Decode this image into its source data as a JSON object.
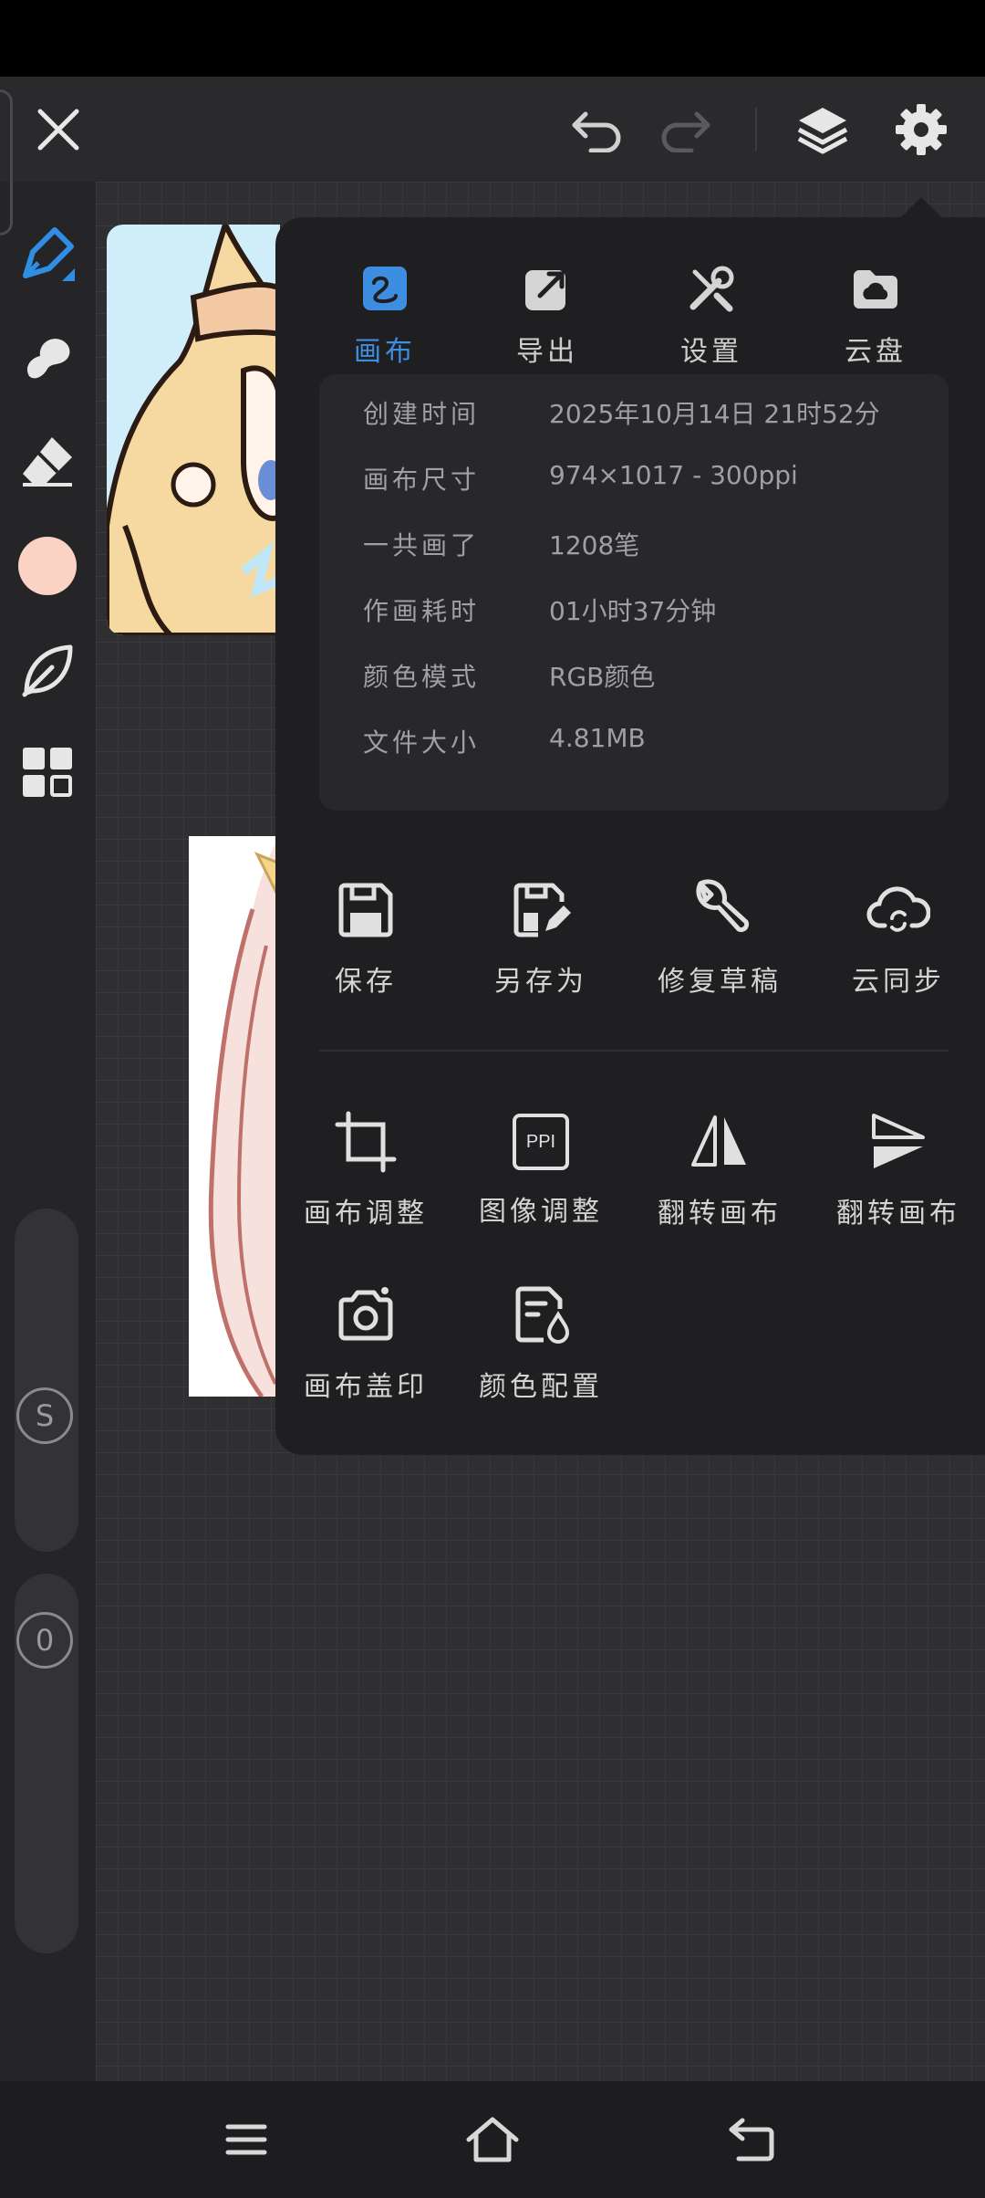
{
  "tabs": [
    {
      "label": "画布",
      "active": true
    },
    {
      "label": "导出",
      "active": false
    },
    {
      "label": "设置",
      "active": false
    },
    {
      "label": "云盘",
      "active": false
    }
  ],
  "info": {
    "created_label": "创建时间",
    "created_value": "2025年10月14日 21时52分",
    "size_label": "画布尺寸",
    "size_value": "974×1017 - 300ppi",
    "strokes_label": "一共画了",
    "strokes_value": "1208笔",
    "time_label": "作画耗时",
    "time_value": "01小时37分钟",
    "color_label": "颜色模式",
    "color_value": "RGB颜色",
    "file_label": "文件大小",
    "file_value": "4.81MB"
  },
  "actions": {
    "save": "保存",
    "save_as": "另存为",
    "repair": "修复草稿",
    "cloud_sync": "云同步",
    "canvas_adjust": "画布调整",
    "image_adjust": "图像调整",
    "flip_h": "翻转画布",
    "flip_v": "翻转画布",
    "stamp": "画布盖印",
    "color_config": "颜色配置"
  },
  "ppi_icon_text": "PPI",
  "sliders": {
    "size_letter": "S",
    "opacity_letter": "0"
  },
  "colors": {
    "accent": "#3d8de0",
    "current_color": "#fbd3c4",
    "panel_bg": "#1f1f21"
  },
  "icons": [
    "close-icon",
    "undo-icon",
    "redo-icon",
    "layers-icon",
    "gear-icon",
    "pen-icon",
    "smudge-icon",
    "eraser-icon",
    "leaf-icon",
    "grid-icon"
  ]
}
